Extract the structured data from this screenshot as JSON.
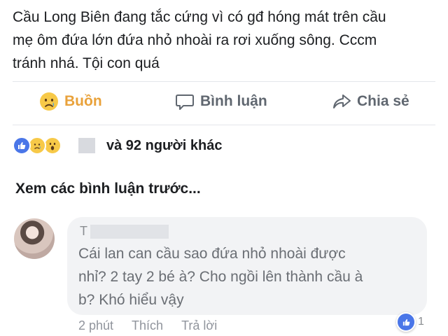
{
  "post": {
    "lines": [
      "Cầu Long Biên đang tắc cứng vì có gđ hóng mát trên cầu",
      "mẹ ôm đứa lớn đứa nhỏ nhoài ra rơi xuống sông. Cccm",
      "tránh nhá. Tội con quá"
    ]
  },
  "actions": {
    "reaction_label": "Buồn",
    "comment_label": "Bình luận",
    "share_label": "Chia sẻ"
  },
  "reactions_summary": {
    "icons": [
      "like-icon",
      "sad-icon",
      "wow-icon"
    ],
    "text": "và 92 người khác"
  },
  "prev_comments": "Xem các bình luận trước...",
  "comment": {
    "author_initial": "T",
    "lines": [
      "Cái lan can cầu sao đứa nhỏ nhoài được",
      "nhỉ? 2 tay 2 bé à? Cho ngồi lên thành cầu à",
      "b? Khó hiểu vậy"
    ],
    "time": "2 phút",
    "like": "Thích",
    "reply": "Trả lời",
    "like_count": "1"
  },
  "colors": {
    "sad_accent": "#e9a23b",
    "like_blue": "#4a76e8",
    "bubble_bg": "#f2f3f5"
  }
}
